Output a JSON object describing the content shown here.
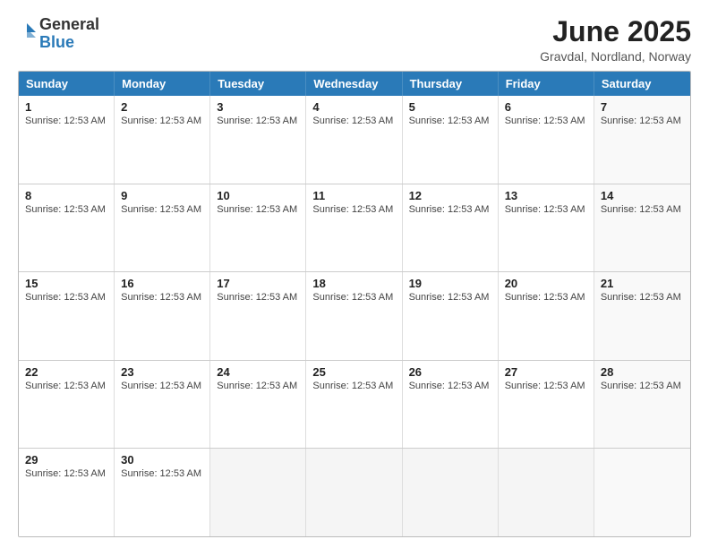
{
  "logo": {
    "general": "General",
    "blue": "Blue"
  },
  "title": "June 2025",
  "subtitle": "Gravdal, Nordland, Norway",
  "days": [
    "Sunday",
    "Monday",
    "Tuesday",
    "Wednesday",
    "Thursday",
    "Friday",
    "Saturday"
  ],
  "sunrise": "Sunrise: 12:53 AM",
  "weeks": [
    [
      {
        "day": "1",
        "empty": false
      },
      {
        "day": "2",
        "empty": false
      },
      {
        "day": "3",
        "empty": false
      },
      {
        "day": "4",
        "empty": false
      },
      {
        "day": "5",
        "empty": false
      },
      {
        "day": "6",
        "empty": false
      },
      {
        "day": "7",
        "empty": false
      }
    ],
    [
      {
        "day": "8",
        "empty": false
      },
      {
        "day": "9",
        "empty": false
      },
      {
        "day": "10",
        "empty": false
      },
      {
        "day": "11",
        "empty": false
      },
      {
        "day": "12",
        "empty": false
      },
      {
        "day": "13",
        "empty": false
      },
      {
        "day": "14",
        "empty": false
      }
    ],
    [
      {
        "day": "15",
        "empty": false
      },
      {
        "day": "16",
        "empty": false
      },
      {
        "day": "17",
        "empty": false
      },
      {
        "day": "18",
        "empty": false
      },
      {
        "day": "19",
        "empty": false
      },
      {
        "day": "20",
        "empty": false
      },
      {
        "day": "21",
        "empty": false
      }
    ],
    [
      {
        "day": "22",
        "empty": false
      },
      {
        "day": "23",
        "empty": false
      },
      {
        "day": "24",
        "empty": false
      },
      {
        "day": "25",
        "empty": false
      },
      {
        "day": "26",
        "empty": false
      },
      {
        "day": "27",
        "empty": false
      },
      {
        "day": "28",
        "empty": false
      }
    ],
    [
      {
        "day": "29",
        "empty": false
      },
      {
        "day": "30",
        "empty": false
      },
      {
        "day": "",
        "empty": true
      },
      {
        "day": "",
        "empty": true
      },
      {
        "day": "",
        "empty": true
      },
      {
        "day": "",
        "empty": true
      },
      {
        "day": "",
        "empty": true
      }
    ]
  ]
}
